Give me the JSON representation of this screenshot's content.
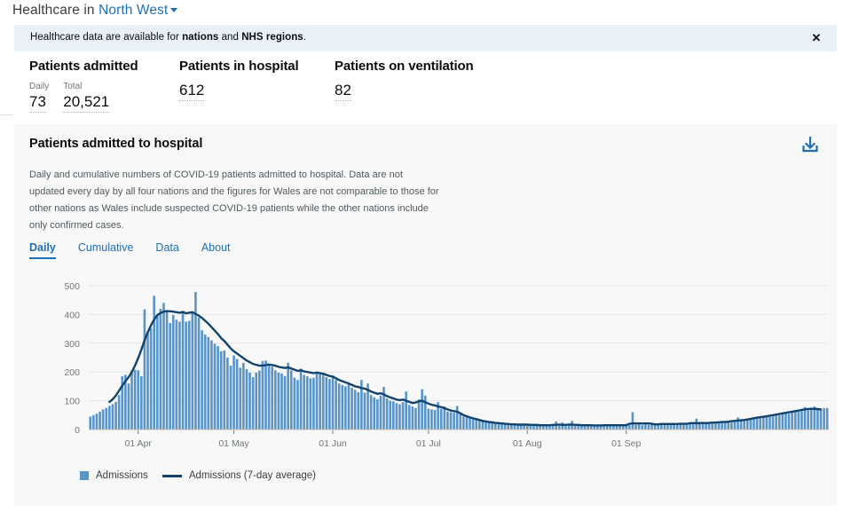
{
  "header": {
    "prefix": "Healthcare in",
    "location": "North West",
    "caret_icon": "chevron-down-icon"
  },
  "banner": {
    "text_start": "Healthcare data are available for ",
    "link1": "nations",
    "text_mid": " and ",
    "link2": "NHS regions",
    "text_end": ".",
    "close_icon": "✕",
    "background": "#e8f1f8"
  },
  "metrics": [
    {
      "title": "Patients admitted",
      "columns": [
        {
          "label": "Daily",
          "value": "73"
        },
        {
          "label": "Total",
          "value": "20,521"
        }
      ]
    },
    {
      "title": "Patients in hospital",
      "columns": [
        {
          "label": "",
          "value": "612"
        }
      ]
    },
    {
      "title": "Patients on ventilation",
      "columns": [
        {
          "label": "",
          "value": "82"
        }
      ]
    }
  ],
  "card": {
    "title": "Patients admitted to hospital",
    "description": "Daily and cumulative numbers of COVID-19 patients admitted to hospital. Data are not updated every day by all four nations and the figures for Wales are not comparable to those for other nations as Wales include suspected COVID-19 patients while the other nations include only confirmed cases.",
    "download_icon": "download-icon",
    "tabs": [
      {
        "label": "Daily",
        "active": true
      },
      {
        "label": "Cumulative",
        "active": false
      },
      {
        "label": "Data",
        "active": false
      },
      {
        "label": "About",
        "active": false
      }
    ]
  },
  "legend": {
    "bar_label": "Admissions",
    "line_label": "Admissions (7-day average)"
  },
  "colors": {
    "bar": "#5694ca",
    "line": "#12436d",
    "link": "#1d70b8",
    "card_bg": "#f8f8f8",
    "banner_bg": "#e8f1f8",
    "grid": "#e6e6e6"
  },
  "chart_data": {
    "type": "bar",
    "title": "Patients admitted to hospital",
    "xlabel": "",
    "ylabel": "",
    "ylim": [
      0,
      500
    ],
    "yticks": [
      0,
      100,
      200,
      300,
      400,
      500
    ],
    "grid": true,
    "legend_position": "bottom-left",
    "xtick_labels": [
      "01 Apr",
      "01 May",
      "01 Jun",
      "01 Jul",
      "01 Aug",
      "01 Sep"
    ],
    "xtick_indices": [
      15,
      45,
      76,
      106,
      137,
      168
    ],
    "x_start_date": "17 Mar",
    "series": [
      {
        "name": "Admissions",
        "type": "bar",
        "values": [
          45,
          50,
          55,
          62,
          70,
          75,
          82,
          88,
          96,
          120,
          185,
          190,
          160,
          205,
          208,
          206,
          185,
          418,
          340,
          352,
          465,
          400,
          420,
          440,
          412,
          370,
          398,
          382,
          375,
          405,
          375,
          378,
          408,
          478,
          390,
          345,
          330,
          322,
          310,
          298,
          290,
          272,
          275,
          250,
          222,
          258,
          245,
          215,
          232,
          210,
          198,
          182,
          198,
          205,
          238,
          240,
          228,
          218,
          206,
          198,
          195,
          186,
          232,
          205,
          180,
          172,
          212,
          190,
          185,
          178,
          180,
          200,
          195,
          190,
          182,
          175,
          188,
          172,
          160,
          155,
          150,
          162,
          145,
          138,
          130,
          172,
          128,
          160,
          120,
          112,
          105,
          118,
          148,
          108,
          100,
          98,
          92,
          88,
          95,
          132,
          85,
          80,
          75,
          105,
          140,
          118,
          72,
          70,
          68,
          95,
          72,
          80,
          62,
          60,
          58,
          82,
          60,
          45,
          42,
          40,
          38,
          35,
          36,
          30,
          28,
          26,
          25,
          24,
          22,
          22,
          20,
          19,
          18,
          18,
          17,
          16,
          16,
          18,
          20,
          15,
          14,
          16,
          15,
          14,
          13,
          14,
          28,
          13,
          25,
          12,
          14,
          30,
          16,
          14,
          15,
          13,
          14,
          16,
          13,
          12,
          14,
          15,
          18,
          17,
          14,
          15,
          16,
          14,
          13,
          15,
          60,
          16,
          18,
          15,
          17,
          16,
          20,
          18,
          17,
          19,
          22,
          20,
          18,
          17,
          16,
          18,
          20,
          22,
          20,
          18,
          38,
          22,
          20,
          21,
          24,
          22,
          25,
          26,
          24,
          28,
          26,
          25,
          30,
          42,
          32,
          30,
          34,
          36,
          40,
          38,
          42,
          45,
          48,
          44,
          46,
          52,
          50,
          54,
          58,
          55,
          60,
          62,
          68,
          64,
          78,
          66,
          72,
          80,
          70,
          68,
          74,
          75
        ]
      },
      {
        "name": "Admissions (7-day average)",
        "type": "line",
        "values": [
          null,
          null,
          null,
          null,
          null,
          null,
          96,
          105,
          118,
          135,
          152,
          168,
          182,
          200,
          222,
          248,
          278,
          310,
          338,
          362,
          382,
          398,
          405,
          410,
          412,
          411,
          410,
          408,
          406,
          409,
          404,
          406,
          408,
          402,
          396,
          388,
          378,
          368,
          356,
          344,
          332,
          318,
          308,
          295,
          282,
          272,
          264,
          256,
          248,
          240,
          234,
          228,
          225,
          222,
          222,
          224,
          226,
          224,
          222,
          218,
          216,
          214,
          216,
          212,
          208,
          204,
          206,
          202,
          200,
          198,
          196,
          198,
          196,
          194,
          190,
          186,
          184,
          178,
          172,
          168,
          164,
          160,
          155,
          150,
          148,
          144,
          142,
          138,
          132,
          128,
          124,
          126,
          122,
          116,
          112,
          108,
          104,
          102,
          104,
          100,
          96,
          92,
          94,
          98,
          100,
          95,
          90,
          86,
          84,
          80,
          78,
          74,
          70,
          66,
          64,
          62,
          56,
          50,
          46,
          42,
          39,
          36,
          33,
          30,
          28,
          26,
          25,
          23,
          22,
          21,
          20,
          19,
          18,
          18,
          17,
          17,
          17,
          17,
          16,
          16,
          16,
          15,
          15,
          15,
          15,
          16,
          16,
          17,
          16,
          16,
          17,
          17,
          16,
          16,
          15,
          15,
          15,
          15,
          14,
          14,
          14,
          15,
          15,
          15,
          15,
          15,
          15,
          15,
          15,
          20,
          21,
          21,
          21,
          21,
          21,
          21,
          20,
          18,
          18,
          19,
          19,
          19,
          19,
          19,
          19,
          20,
          20,
          20,
          22,
          22,
          22,
          22,
          23,
          22,
          23,
          24,
          24,
          25,
          26,
          26,
          27,
          29,
          30,
          31,
          32,
          33,
          35,
          37,
          39,
          41,
          43,
          44,
          46,
          48,
          50,
          52,
          54,
          56,
          58,
          60,
          62,
          64,
          66,
          68,
          70,
          71,
          72,
          72,
          71,
          70
        ]
      }
    ]
  }
}
